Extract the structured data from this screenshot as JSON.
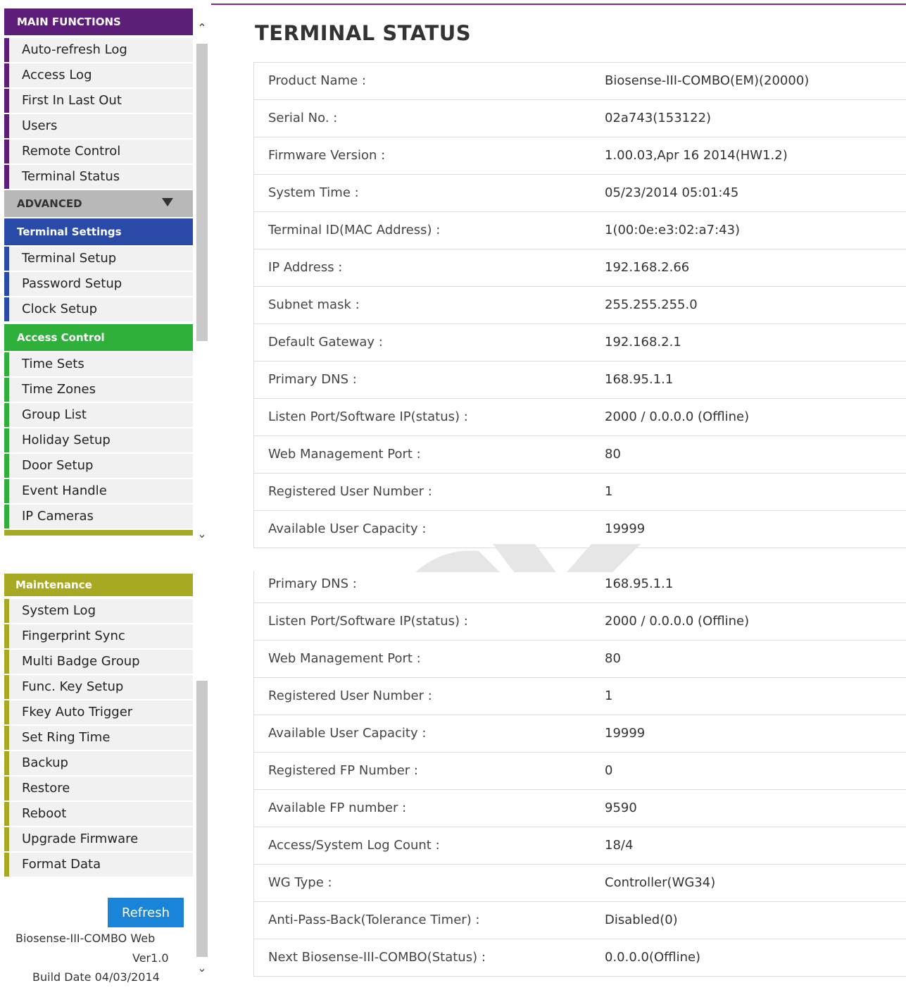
{
  "page_title": "TERMINAL STATUS",
  "sidebar": {
    "main_functions": {
      "title": "MAIN FUNCTIONS",
      "items": [
        "Auto-refresh Log",
        "Access Log",
        "First In Last Out",
        "Users",
        "Remote Control",
        "Terminal Status"
      ]
    },
    "advanced": {
      "title": "ADVANCED"
    },
    "terminal_settings": {
      "title": "Terminal Settings",
      "items": [
        "Terminal Setup",
        "Password Setup",
        "Clock Setup"
      ]
    },
    "access_control": {
      "title": "Access Control",
      "items": [
        "Time Sets",
        "Time Zones",
        "Group List",
        "Holiday Setup",
        "Door Setup",
        "Event Handle",
        "IP Cameras"
      ]
    },
    "maintenance": {
      "title": "Maintenance",
      "items": [
        "System Log",
        "Fingerprint Sync",
        "Multi Badge Group",
        "Func. Key Setup",
        "Fkey Auto Trigger",
        "Set Ring Time",
        "Backup",
        "Restore",
        "Reboot",
        "Upgrade Firmware",
        "Format Data"
      ]
    },
    "refresh_label": "Refresh",
    "footer": {
      "product": "Biosense-III-COMBO Web",
      "version": "Ver1.0",
      "build": "Build Date 04/03/2014"
    }
  },
  "status_table_top": [
    {
      "label": "Product Name :",
      "value": "Biosense-III-COMBO(EM)(20000)"
    },
    {
      "label": "Serial No. :",
      "value": "02a743(153122)"
    },
    {
      "label": "Firmware Version :",
      "value": "1.00.03,Apr 16 2014(HW1.2)"
    },
    {
      "label": "System Time :",
      "value": "05/23/2014 05:01:45"
    },
    {
      "label": "Terminal ID(MAC Address) :",
      "value": "1(00:0e:e3:02:a7:43)"
    },
    {
      "label": "IP Address :",
      "value": "192.168.2.66"
    },
    {
      "label": "Subnet mask :",
      "value": "255.255.255.0"
    },
    {
      "label": "Default Gateway :",
      "value": "192.168.2.1"
    },
    {
      "label": "Primary DNS :",
      "value": "168.95.1.1"
    },
    {
      "label": "Listen Port/Software IP(status) :",
      "value": "2000 / 0.0.0.0 (Offline)"
    },
    {
      "label": "Web Management Port :",
      "value": "80"
    },
    {
      "label": "Registered User Number :",
      "value": "1"
    },
    {
      "label": "Available User Capacity :",
      "value": "19999"
    }
  ],
  "status_table_bottom": [
    {
      "label": "Primary DNS :",
      "value": "168.95.1.1"
    },
    {
      "label": "Listen Port/Software IP(status) :",
      "value": "2000 / 0.0.0.0 (Offline)"
    },
    {
      "label": "Web Management Port :",
      "value": "80"
    },
    {
      "label": "Registered User Number :",
      "value": "1"
    },
    {
      "label": "Available User Capacity :",
      "value": "19999"
    },
    {
      "label": "Registered FP Number :",
      "value": "0"
    },
    {
      "label": "Available FP number :",
      "value": "9590"
    },
    {
      "label": "Access/System Log Count :",
      "value": "18/4"
    },
    {
      "label": "WG Type :",
      "value": "Controller(WG34)"
    },
    {
      "label": "Anti-Pass-Back(Tolerance Timer) :",
      "value": "Disabled(0)"
    },
    {
      "label": "Next Biosense-III-COMBO(Status) :",
      "value": "0.0.0.0(Offline)"
    }
  ],
  "icons": {
    "scroll_up": "chevron-up-icon",
    "scroll_down": "chevron-down-icon",
    "expand": "triangle-down-icon"
  },
  "colors": {
    "main_functions": "#5c1e78",
    "terminal_settings": "#2a4aa8",
    "access_control": "#2eb03a",
    "maintenance": "#a8a922",
    "refresh_button": "#1a84d8"
  }
}
